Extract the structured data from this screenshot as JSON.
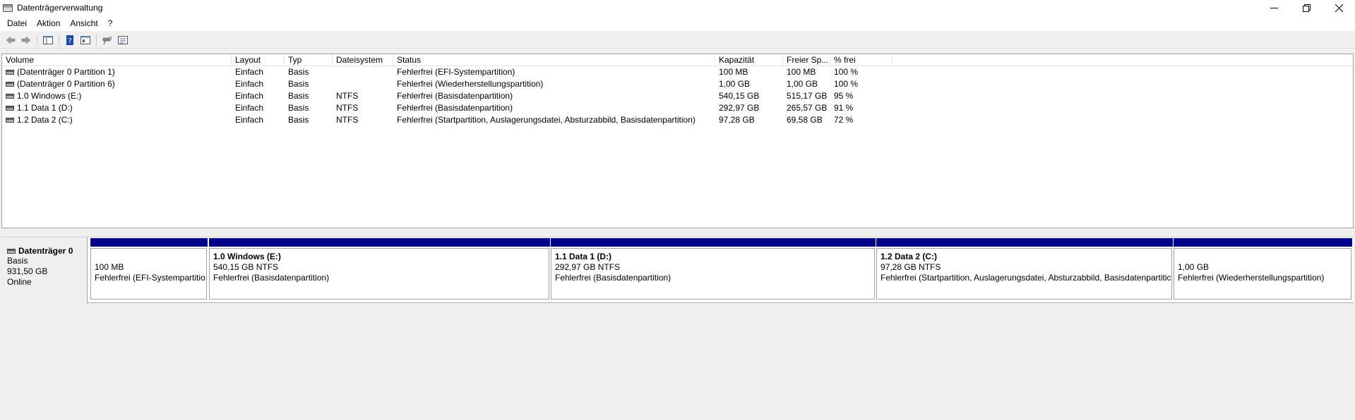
{
  "window": {
    "title": "Datenträgerverwaltung"
  },
  "menu": [
    "Datei",
    "Aktion",
    "Ansicht",
    "?"
  ],
  "toolbar": {
    "icons": [
      "back-arrow-icon",
      "forward-arrow-icon",
      "console-tree-icon",
      "help-icon",
      "properties-icon",
      "rescan-disks-icon",
      "list-view-icon"
    ]
  },
  "columns": [
    "Volume",
    "Layout",
    "Typ",
    "Dateisystem",
    "Status",
    "Kapazität",
    "Freier Sp...",
    "% frei"
  ],
  "volumes": [
    [
      "(Datenträger 0 Partition 1)",
      "Einfach",
      "Basis",
      "",
      "Fehlerfrei (EFI-Systempartition)",
      "100 MB",
      "100 MB",
      "100 %"
    ],
    [
      "(Datenträger 0 Partition 6)",
      "Einfach",
      "Basis",
      "",
      "Fehlerfrei (Wiederherstellungspartition)",
      "1,00 GB",
      "1,00 GB",
      "100 %"
    ],
    [
      "1.0 Windows (E:)",
      "Einfach",
      "Basis",
      "NTFS",
      "Fehlerfrei (Basisdatenpartition)",
      "540,15 GB",
      "515,17 GB",
      "95 %"
    ],
    [
      "1.1 Data 1 (D:)",
      "Einfach",
      "Basis",
      "NTFS",
      "Fehlerfrei (Basisdatenpartition)",
      "292,97 GB",
      "265,57 GB",
      "91 %"
    ],
    [
      "1.2 Data 2 (C:)",
      "Einfach",
      "Basis",
      "NTFS",
      "Fehlerfrei (Startpartition, Auslagerungsdatei, Absturzabbild, Basisdatenpartition)",
      "97,28 GB",
      "69,58 GB",
      "72 %"
    ]
  ],
  "disk": {
    "name": "Datenträger 0",
    "type": "Basis",
    "size": "931,50 GB",
    "state": "Online",
    "partitions": [
      {
        "title": "",
        "size": "100 MB",
        "status": "Fehlerfrei (EFI-Systempartitio"
      },
      {
        "title": "1.0 Windows  (E:)",
        "size": "540,15 GB NTFS",
        "status": "Fehlerfrei (Basisdatenpartition)"
      },
      {
        "title": "1.1 Data 1  (D:)",
        "size": "292,97 GB NTFS",
        "status": "Fehlerfrei (Basisdatenpartition)"
      },
      {
        "title": "1.2 Data 2  (C:)",
        "size": "97,28 GB NTFS",
        "status": "Fehlerfrei (Startpartition, Auslagerungsdatei, Absturzabbild, Basisdatenpartitic"
      },
      {
        "title": "",
        "size": "1,00 GB",
        "status": "Fehlerfrei (Wiederherstellungspartition)"
      }
    ]
  },
  "colors": {
    "partition_bar": "#00008b"
  }
}
